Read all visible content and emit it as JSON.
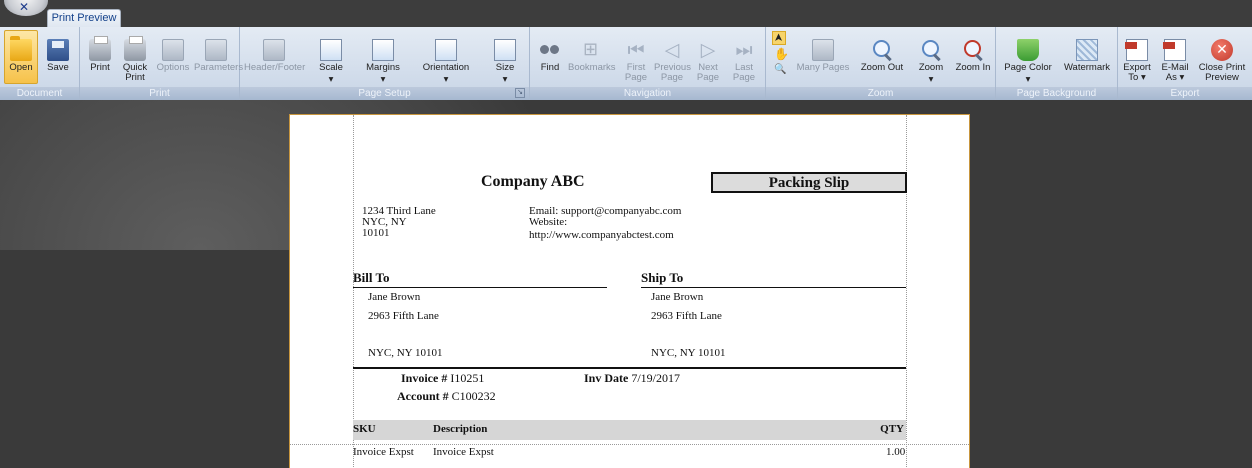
{
  "app": {
    "tab_label": "Print Preview"
  },
  "ribbon": {
    "groups": [
      {
        "label": "Document",
        "buttons": [
          {
            "label": "Open"
          },
          {
            "label": "Save"
          }
        ]
      },
      {
        "label": "Print",
        "buttons": [
          {
            "label": "Print"
          },
          {
            "label": "Quick\nPrint"
          },
          {
            "label": "Options"
          },
          {
            "label": "Parameters"
          }
        ]
      },
      {
        "label": "Page Setup",
        "buttons": [
          {
            "label": "Header/Footer"
          },
          {
            "label": "Scale"
          },
          {
            "label": "Margins"
          },
          {
            "label": "Orientation"
          },
          {
            "label": "Size"
          }
        ]
      },
      {
        "label": "Navigation",
        "buttons": [
          {
            "label": "Find"
          },
          {
            "label": "Bookmarks"
          },
          {
            "label": "First\nPage"
          },
          {
            "label": "Previous\nPage"
          },
          {
            "label": "Next\nPage"
          },
          {
            "label": "Last\nPage"
          }
        ]
      },
      {
        "label": "Zoom",
        "buttons": [
          {
            "label": "Many Pages"
          },
          {
            "label": "Zoom Out"
          },
          {
            "label": "Zoom"
          },
          {
            "label": "Zoom In"
          }
        ]
      },
      {
        "label": "Page Background",
        "buttons": [
          {
            "label": "Page Color"
          },
          {
            "label": "Watermark"
          }
        ]
      },
      {
        "label": "Export",
        "buttons": [
          {
            "label": "Export\nTo ▾"
          },
          {
            "label": "E-Mail\nAs ▾"
          },
          {
            "label": "Close Print\nPreview"
          }
        ]
      }
    ]
  },
  "document": {
    "company_name": "Company ABC",
    "slip_title": "Packing Slip",
    "address_lines": [
      "1234 Third Lane",
      "NYC, NY",
      "10101"
    ],
    "email": "Email: support@companyabc.com",
    "website_label": "Website:",
    "website_url": "http://www.companyabctest.com",
    "bill_to": {
      "heading": "Bill To",
      "name": "Jane Brown",
      "street": "2963 Fifth Lane",
      "city": "NYC, NY 10101"
    },
    "ship_to": {
      "heading": "Ship To",
      "name": "Jane Brown",
      "street": "2963 Fifth Lane",
      "city": "NYC, NY 10101"
    },
    "invoice_label": "Invoice #",
    "invoice_no": "I10251",
    "inv_date_label": "Inv Date",
    "inv_date": "7/19/2017",
    "account_label": "Account #",
    "account_no": "C100232",
    "table": {
      "headers": {
        "sku": "SKU",
        "description": "Description",
        "qty": "QTY"
      },
      "rows": [
        {
          "sku": "Invoice Expst",
          "description": "Invoice Expst",
          "qty": "1.00"
        }
      ]
    }
  },
  "colors": {
    "ribbon": "#d6e1ef",
    "viewer": "#3a3a3a",
    "page_border": "#c8963e",
    "accent": "#15428b"
  }
}
